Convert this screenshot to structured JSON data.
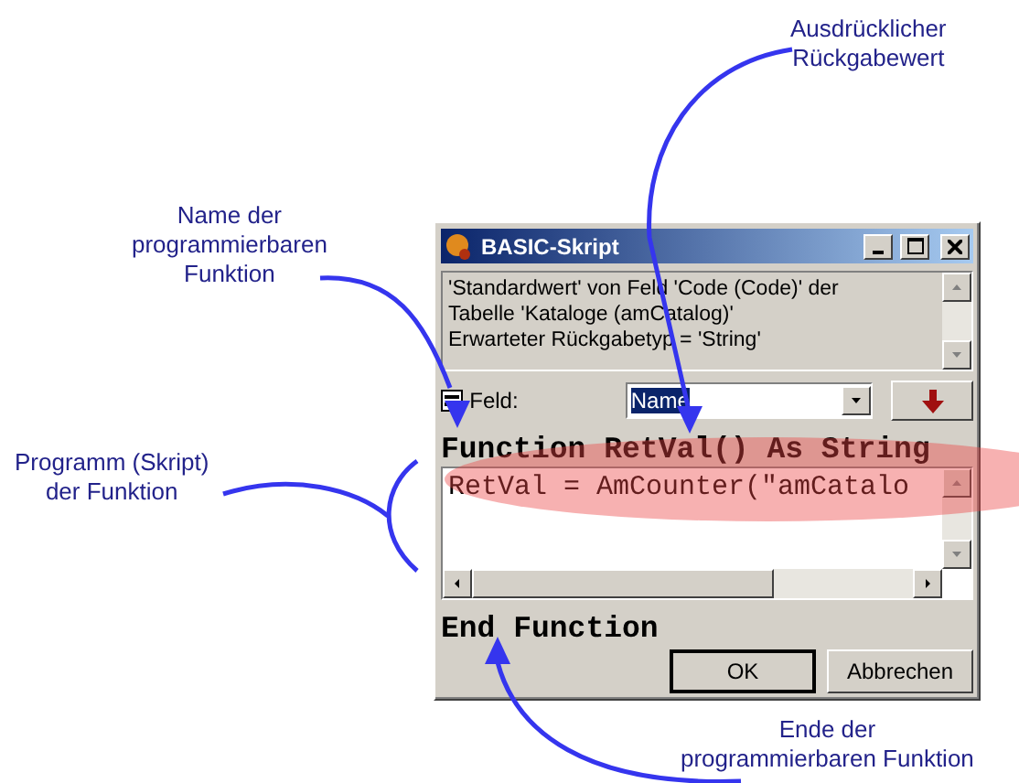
{
  "callouts": [
    {
      "lines": [
        "Ausdrücklicher",
        "Rückgabewert"
      ]
    },
    {
      "lines": [
        "Name der",
        "programmierbaren",
        "Funktion"
      ]
    },
    {
      "lines": [
        "Programm (Skript)",
        "der Funktion"
      ]
    },
    {
      "lines": [
        "Ende der",
        "programmierbaren Funktion"
      ]
    }
  ],
  "window": {
    "title": "BASIC-Skript",
    "info_lines": [
      "'Standardwert' von Feld 'Code (Code)' der",
      "Tabelle 'Kataloge (amCatalog)'",
      "Erwarteter Rückgabetyp = 'String'"
    ],
    "field": {
      "label": "Feld:",
      "value": "Name",
      "selected": true
    },
    "function_header": "Function RetVal() As String",
    "code_line": "RetVal = AmCounter(\"amCatalo",
    "end_line": "End Function",
    "buttons": [
      {
        "label": "OK",
        "default": true
      },
      {
        "label": "Abbrechen",
        "default": false
      }
    ]
  }
}
